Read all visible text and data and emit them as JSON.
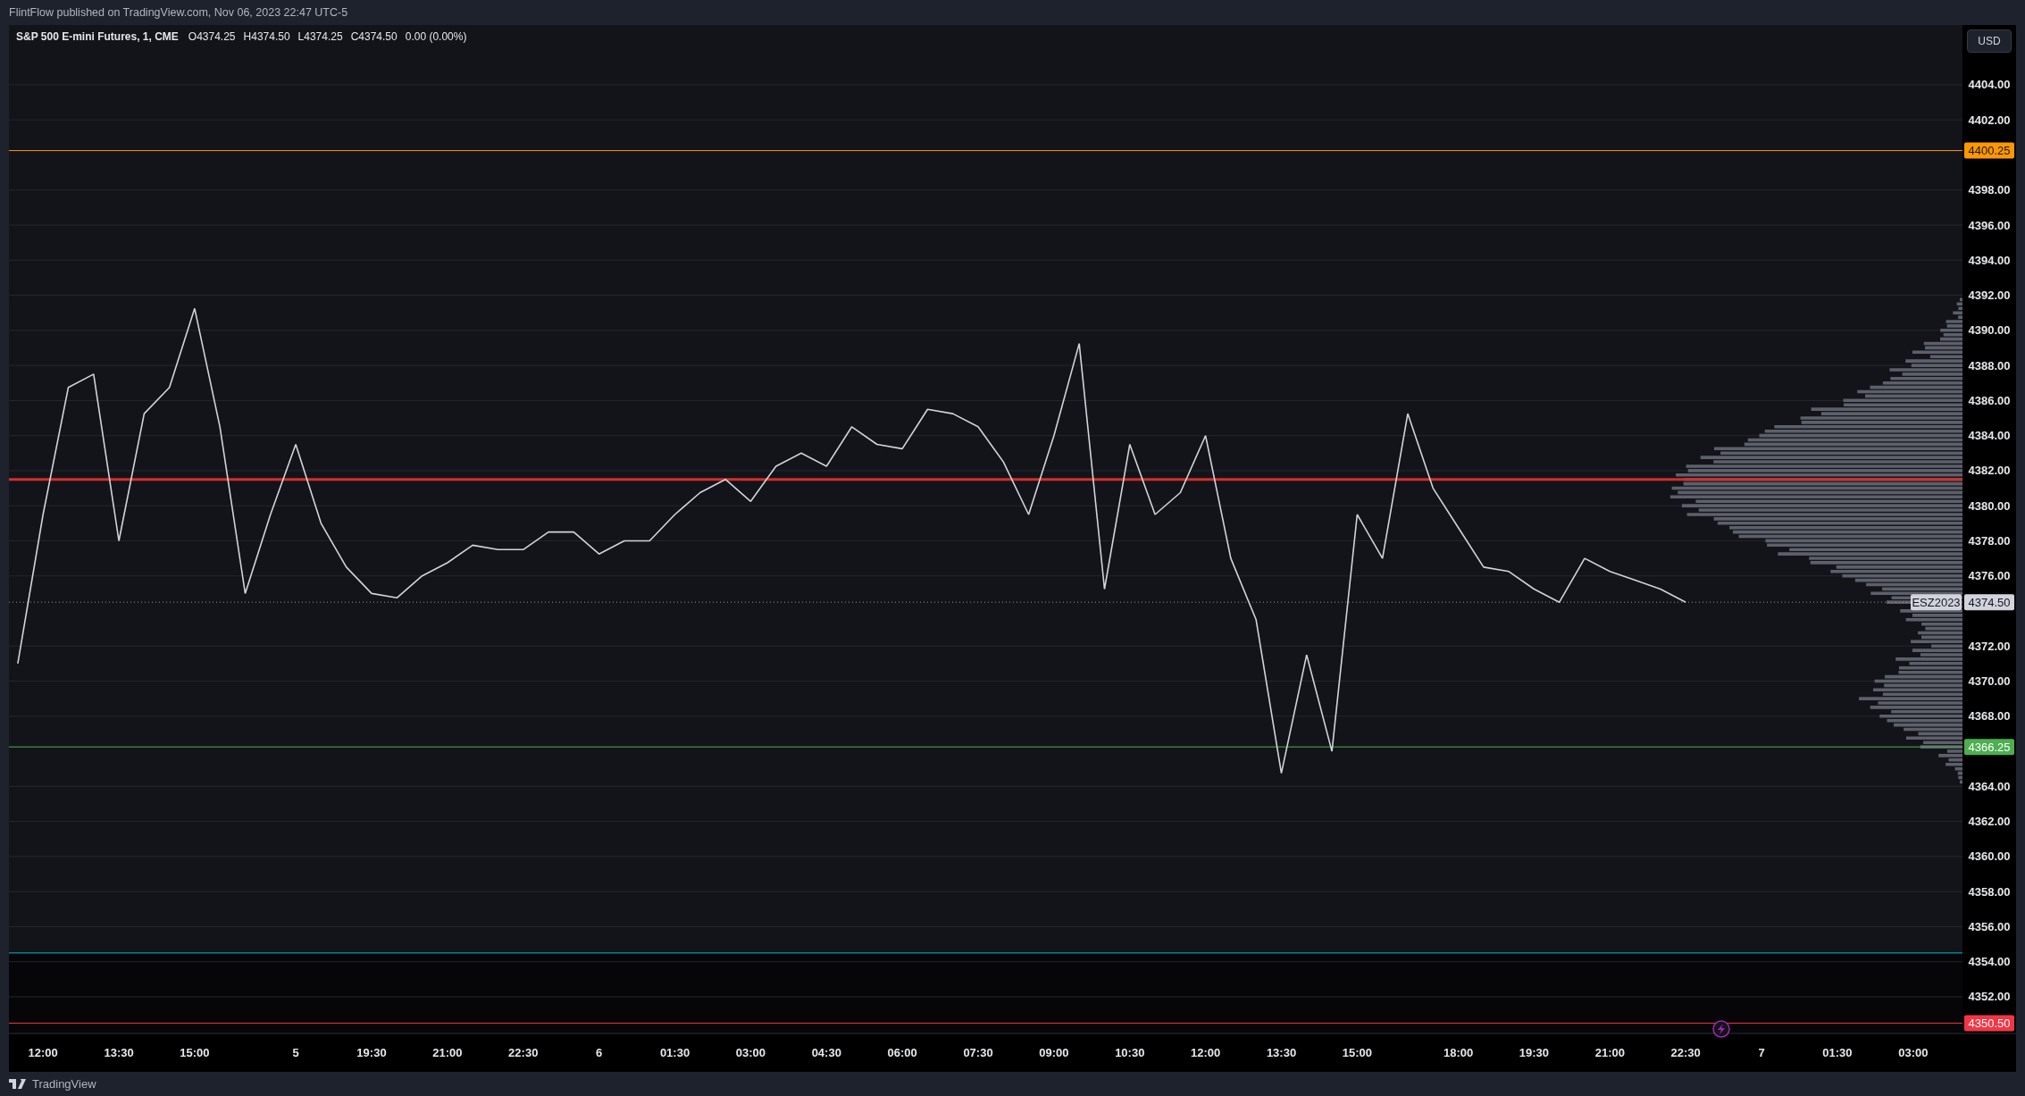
{
  "header": {
    "text": "FlintFlow published on TradingView.com, Nov 06, 2023 22:47 UTC-5"
  },
  "legend": {
    "title": "S&P 500 E-mini Futures, 1, CME",
    "values": [
      "O4374.25",
      "H4374.50",
      "L4374.25",
      "C4374.50",
      "0.00 (0.00%)"
    ]
  },
  "currency_button": "USD",
  "chart_data": {
    "type": "line",
    "categories": [
      null,
      "12:00",
      null,
      null,
      "13:30",
      null,
      null,
      "15:00",
      null,
      null,
      null,
      "5",
      null,
      null,
      "19:30",
      null,
      null,
      "21:00",
      null,
      null,
      "22:30",
      null,
      null,
      "6",
      null,
      null,
      "01:30",
      null,
      null,
      "03:00",
      null,
      null,
      "04:30",
      null,
      null,
      "06:00",
      null,
      null,
      "07:30",
      null,
      null,
      "09:00",
      null,
      null,
      "10:30",
      null,
      null,
      "12:00",
      null,
      null,
      "13:30",
      null,
      null,
      "15:00",
      null,
      null,
      null,
      "18:00",
      null,
      null,
      "19:30",
      null,
      null,
      "21:00",
      null,
      null,
      "22:30",
      null,
      null,
      "7",
      null,
      null,
      "01:30",
      null,
      null,
      "03:00",
      null
    ],
    "series": [
      {
        "name": "ESZ2023",
        "color": "#d1d4dc",
        "values": [
          4371.0,
          4379.5,
          4386.75,
          4387.5,
          4378.0,
          4385.25,
          4386.75,
          4391.25,
          4384.5,
          4375.0,
          4379.5,
          4383.5,
          4379.0,
          4376.5,
          4375.0,
          4374.75,
          4376.0,
          4376.75,
          4377.75,
          4377.5,
          4377.5,
          4378.5,
          4378.5,
          4377.25,
          4378.0,
          4378.0,
          4379.5,
          4380.75,
          4381.5,
          4380.25,
          4382.25,
          4383.0,
          4382.25,
          4384.5,
          4383.5,
          4383.25,
          4385.5,
          4385.25,
          4384.5,
          4382.5,
          4379.5,
          4384.0,
          4389.25,
          4375.25,
          4383.5,
          4379.5,
          4380.75,
          4384.0,
          4377.0,
          4373.5,
          4364.75,
          4371.5,
          4366.0,
          4379.5,
          4377.0,
          4385.25,
          4381.0,
          4378.75,
          4376.5,
          4376.25,
          4375.25,
          4374.5,
          4377.0,
          4376.25,
          4375.75,
          4375.25,
          4374.5,
          null,
          null,
          null,
          null,
          null,
          null,
          null,
          null,
          null,
          null
        ]
      }
    ],
    "ylim": [
      4349.91,
      4407.41
    ],
    "yticks": [
      {
        "value": 4404,
        "label": "4404.00"
      },
      {
        "value": 4402,
        "label": "4402.00"
      },
      {
        "value": 4398,
        "label": "4398.00"
      },
      {
        "value": 4396,
        "label": "4396.00"
      },
      {
        "value": 4394,
        "label": "4394.00"
      },
      {
        "value": 4392,
        "label": "4392.00"
      },
      {
        "value": 4390,
        "label": "4390.00"
      },
      {
        "value": 4388,
        "label": "4388.00"
      },
      {
        "value": 4386,
        "label": "4386.00"
      },
      {
        "value": 4384,
        "label": "4384.00"
      },
      {
        "value": 4382,
        "label": "4382.00"
      },
      {
        "value": 4380,
        "label": "4380.00"
      },
      {
        "value": 4378,
        "label": "4378.00"
      },
      {
        "value": 4376,
        "label": "4376.00"
      },
      {
        "value": 4372,
        "label": "4372.00"
      },
      {
        "value": 4370,
        "label": "4370.00"
      },
      {
        "value": 4368,
        "label": "4368.00"
      },
      {
        "value": 4364,
        "label": "4364.00"
      },
      {
        "value": 4362,
        "label": "4362.00"
      },
      {
        "value": 4360,
        "label": "4360.00"
      },
      {
        "value": 4358,
        "label": "4358.00"
      },
      {
        "value": 4356,
        "label": "4356.00"
      },
      {
        "value": 4354,
        "label": "4354.00"
      },
      {
        "value": 4352,
        "label": "4352.00"
      }
    ],
    "ref_lines": [
      {
        "axis": "y",
        "value": 4400.25,
        "color": "#ff9800",
        "label": "4400.25"
      },
      {
        "axis": "y",
        "value": 4381.5,
        "color": "#d32f2f"
      },
      {
        "axis": "y",
        "value": 4374.5,
        "color": "#9598a1",
        "label": "4374.50"
      },
      {
        "axis": "y",
        "value": 4366.25,
        "color": "#4caf50",
        "label": "4366.25"
      },
      {
        "axis": "y",
        "value": 4354.5,
        "color": "#00bcd4"
      },
      {
        "axis": "y",
        "value": 4350.5,
        "color": "#f23645",
        "label": "4350.50"
      }
    ],
    "bands": [
      {
        "axis": "y",
        "from": 4349.91,
        "to": 4354.5,
        "color": "#060608"
      }
    ],
    "grid": true
  },
  "footer": {
    "brand": "TradingView"
  }
}
